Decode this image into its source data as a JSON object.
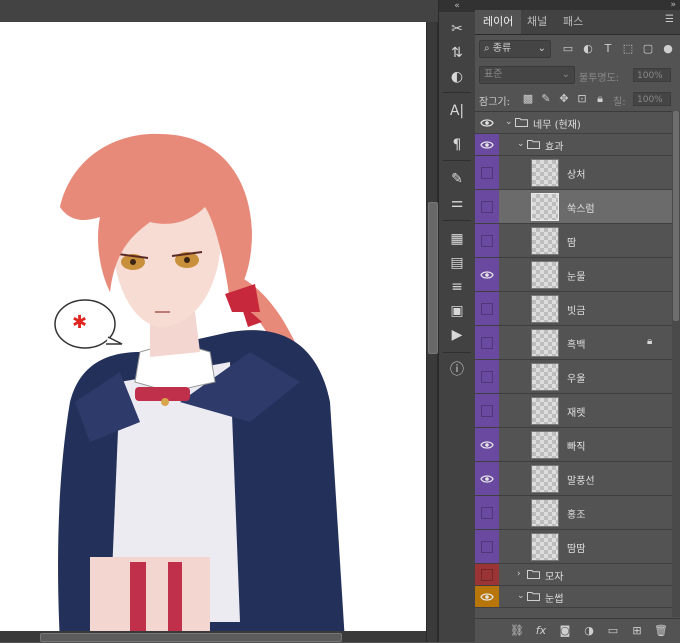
{
  "panel": {
    "tabs": [
      {
        "label": "레이어",
        "active": true
      },
      {
        "label": "채널",
        "active": false
      },
      {
        "label": "패스",
        "active": false
      }
    ],
    "filter": {
      "kind_label": "종류"
    },
    "blend": {
      "mode": "표준",
      "opacity_label": "불투명도:",
      "opacity_value": "100%"
    },
    "lock": {
      "label": "잠그기:",
      "fill_label": "칠:",
      "fill_value": "100%"
    }
  },
  "layers": [
    {
      "name": "네무 (현재)",
      "type": "group",
      "indent": 0,
      "visible": true,
      "color": "#535353",
      "expanded": true
    },
    {
      "name": "효과",
      "type": "group",
      "indent": 1,
      "visible": true,
      "color": "#6a4aa0",
      "expanded": true
    },
    {
      "name": "상처",
      "type": "layer",
      "indent": 2,
      "visible": false,
      "color": "#6a4aa0"
    },
    {
      "name": "쑥스럼",
      "type": "layer",
      "indent": 2,
      "visible": false,
      "color": "#6a4aa0",
      "selected": true
    },
    {
      "name": "땀",
      "type": "layer",
      "indent": 2,
      "visible": false,
      "color": "#6a4aa0"
    },
    {
      "name": "눈물",
      "type": "layer",
      "indent": 2,
      "visible": true,
      "color": "#6a4aa0"
    },
    {
      "name": "빗금",
      "type": "layer",
      "indent": 2,
      "visible": false,
      "color": "#6a4aa0"
    },
    {
      "name": "흑백",
      "type": "layer",
      "indent": 2,
      "visible": false,
      "color": "#6a4aa0",
      "locked": true
    },
    {
      "name": "우울",
      "type": "layer",
      "indent": 2,
      "visible": false,
      "color": "#6a4aa0"
    },
    {
      "name": "재렛",
      "type": "layer",
      "indent": 2,
      "visible": false,
      "color": "#6a4aa0"
    },
    {
      "name": "빠직",
      "type": "layer",
      "indent": 2,
      "visible": true,
      "color": "#6a4aa0"
    },
    {
      "name": "말풍선",
      "type": "layer",
      "indent": 2,
      "visible": true,
      "color": "#6a4aa0"
    },
    {
      "name": "홍조",
      "type": "layer",
      "indent": 2,
      "visible": false,
      "color": "#6a4aa0"
    },
    {
      "name": "땀땀",
      "type": "layer",
      "indent": 2,
      "visible": false,
      "color": "#6a4aa0"
    },
    {
      "name": "모자",
      "type": "group",
      "indent": 1,
      "visible": false,
      "color": "#9b3434",
      "expanded": false
    },
    {
      "name": "눈썹",
      "type": "group",
      "indent": 1,
      "visible": true,
      "color": "#b8760a",
      "expanded": true
    }
  ],
  "bottom_icons": [
    "link-icon",
    "fx-icon",
    "mask-icon",
    "adjustment-icon",
    "new-group-icon",
    "new-layer-icon",
    "delete-icon"
  ],
  "bottom_labels": {
    "fx": "fx"
  },
  "canvas": {
    "speech_bubble_icon": "anger-mark-icon"
  }
}
